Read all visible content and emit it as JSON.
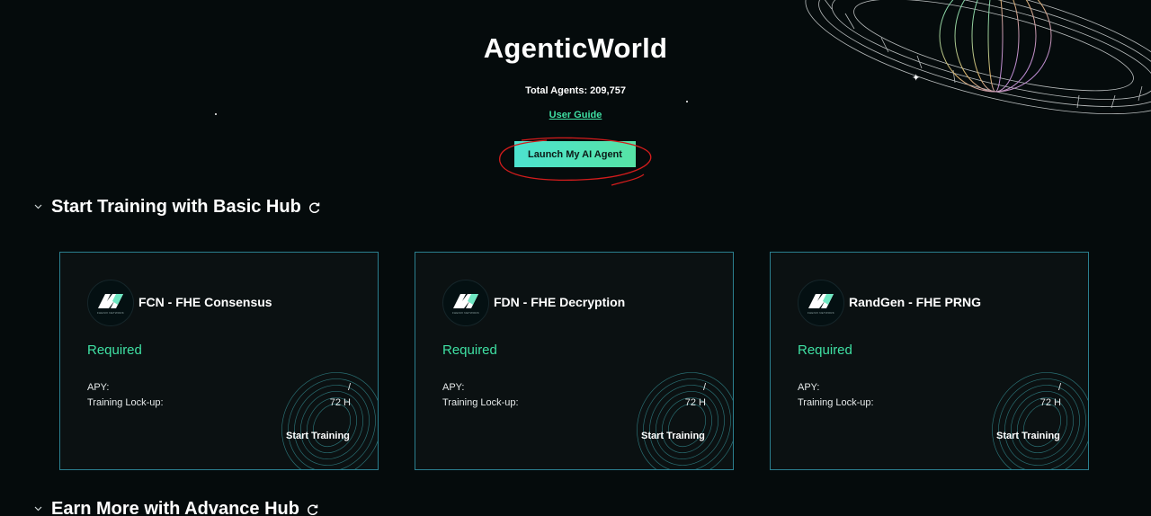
{
  "app": {
    "title": "AgenticWorld",
    "total_agents": "Total Agents: 209,757",
    "user_guide": "User Guide",
    "launch_button": "Launch My AI Agent"
  },
  "sections": [
    {
      "title": "Start Training with Basic Hub",
      "expanded": true
    },
    {
      "title": "Earn More with Advance Hub",
      "expanded": true
    }
  ],
  "cards": [
    {
      "name": "FCN - FHE Consensus",
      "logo_text": "FHENIX NETWORK",
      "status": "Required",
      "apy_label": "APY:",
      "apy_value": "/",
      "lockup_label": "Training Lock-up:",
      "lockup_value": "72 H",
      "action": "Start Training"
    },
    {
      "name": "FDN - FHE Decryption",
      "logo_text": "FHENIX NETWORK",
      "status": "Required",
      "apy_label": "APY:",
      "apy_value": "/",
      "lockup_label": "Training Lock-up:",
      "lockup_value": "72 H",
      "action": "Start Training"
    },
    {
      "name": "RandGen - FHE PRNG",
      "logo_text": "FHENIX NETWORK",
      "status": "Required",
      "apy_label": "APY:",
      "apy_value": "/",
      "lockup_label": "Training Lock-up:",
      "lockup_value": "72 H",
      "action": "Start Training"
    }
  ],
  "icons": {
    "section_toggle": "chevron-down-icon",
    "section_refresh": "refresh-icon",
    "card_logo": "hexagon-logo-icon",
    "decoration": "planet-wireframe"
  },
  "colors": {
    "background": "#050b0c",
    "accent_green": "#3fe0a3",
    "button_gradient_start": "#4de3cf",
    "button_gradient_end": "#56e3a5",
    "card_border": "#2b7f8f",
    "annotation_red": "#d41c1c"
  }
}
